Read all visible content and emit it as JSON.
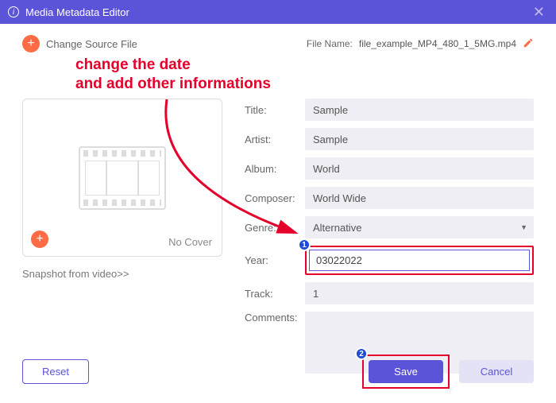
{
  "window": {
    "title": "Media Metadata Editor"
  },
  "header": {
    "change_source": "Change Source File",
    "file_label": "File Name:",
    "file_name": "file_example_MP4_480_1_5MG.mp4"
  },
  "annotation": {
    "line1": "change the date",
    "line2": "and add other informations",
    "badge1": "1",
    "badge2": "2"
  },
  "cover": {
    "no_cover": "No Cover",
    "snapshot": "Snapshot from video>>"
  },
  "fields": {
    "title_label": "Title:",
    "title_value": "Sample",
    "artist_label": "Artist:",
    "artist_value": "Sample",
    "album_label": "Album:",
    "album_value": "World",
    "composer_label": "Composer:",
    "composer_value": "World Wide",
    "genre_label": "Genre:",
    "genre_value": "Alternative",
    "year_label": "Year:",
    "year_value": "03022022",
    "track_label": "Track:",
    "track_value": "1",
    "comments_label": "Comments:",
    "comments_value": ""
  },
  "buttons": {
    "reset": "Reset",
    "save": "Save",
    "cancel": "Cancel"
  }
}
